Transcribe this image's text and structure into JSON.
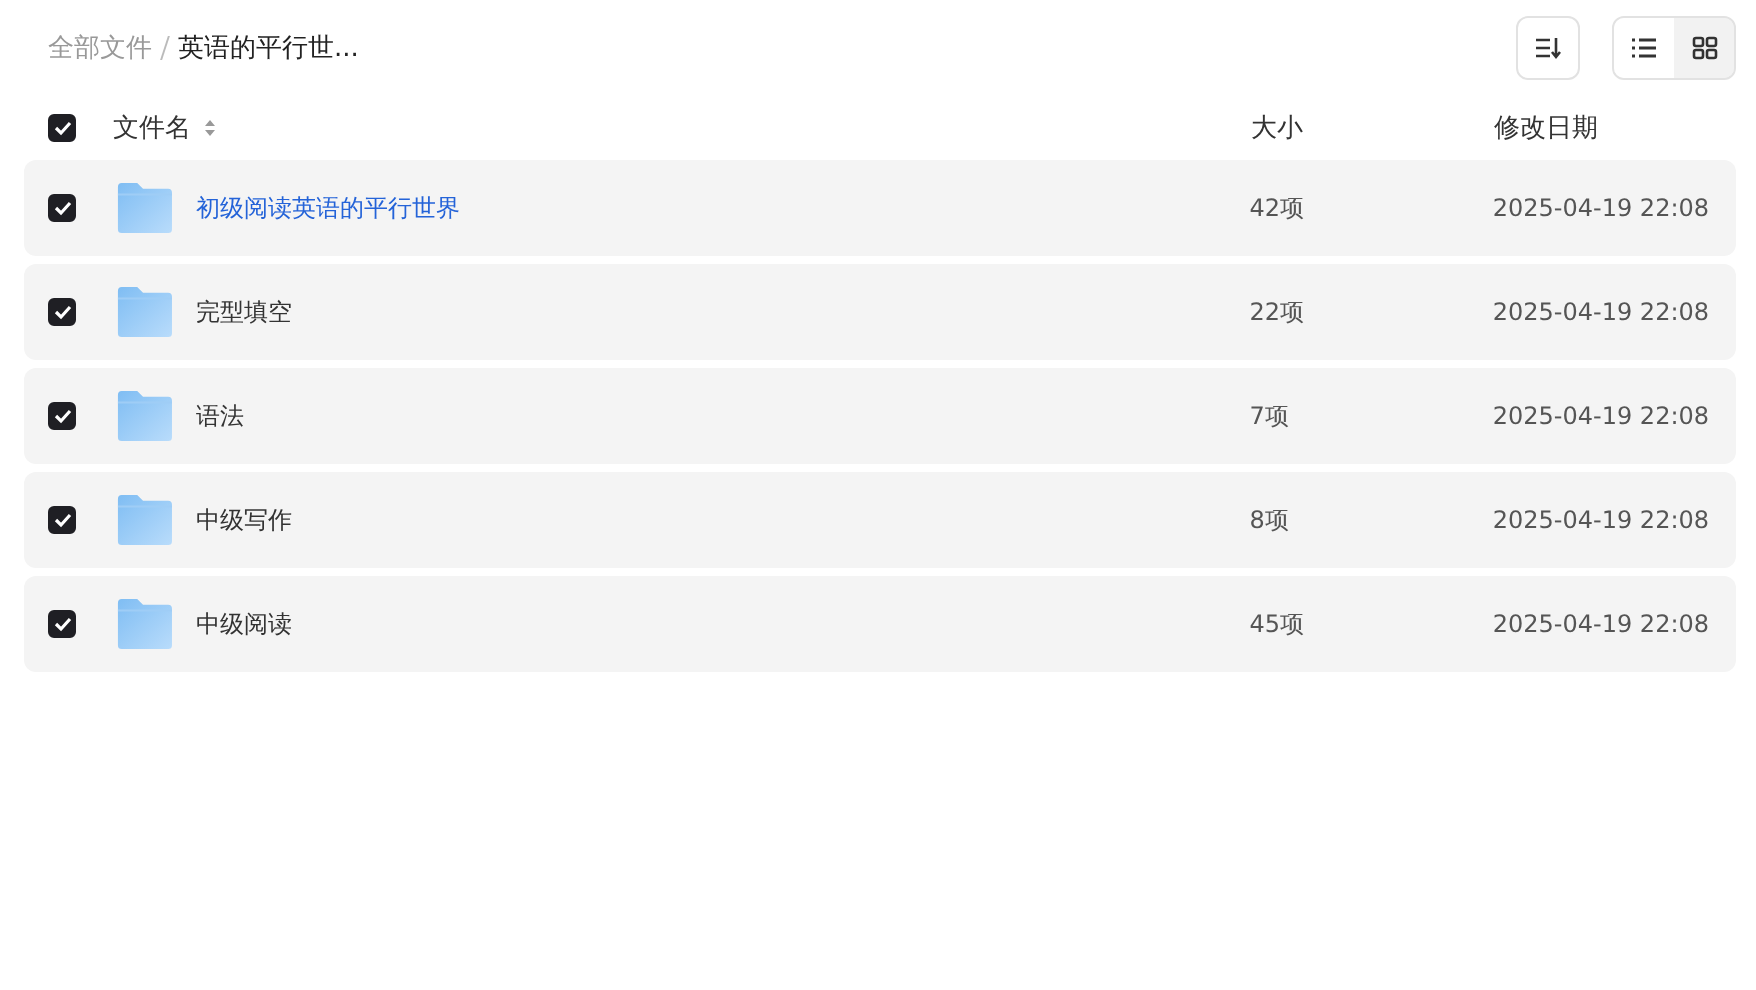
{
  "breadcrumb": [
    {
      "label": "全部文件",
      "current": false
    },
    {
      "label": "英语的平行世...",
      "current": true
    }
  ],
  "view_modes": [
    {
      "kind": "list",
      "selected": true
    },
    {
      "kind": "grid",
      "selected": false
    }
  ],
  "header": {
    "checked": true,
    "name": "文件名",
    "size": "大小",
    "modified": "修改日期"
  },
  "rows": [
    {
      "name": "初级阅读英语的平行世界",
      "size": "42项",
      "modified": "2025-04-19 22:08",
      "checked": true,
      "highlighted": true
    },
    {
      "name": "完型填空",
      "size": "22项",
      "modified": "2025-04-19 22:08",
      "checked": true,
      "highlighted": false
    },
    {
      "name": "语法",
      "size": "7项",
      "modified": "2025-04-19 22:08",
      "checked": true,
      "highlighted": false
    },
    {
      "name": "中级写作",
      "size": "8项",
      "modified": "2025-04-19 22:08",
      "checked": true,
      "highlighted": false
    },
    {
      "name": "中级阅读",
      "size": "45项",
      "modified": "2025-04-19 22:08",
      "checked": true,
      "highlighted": false
    }
  ]
}
